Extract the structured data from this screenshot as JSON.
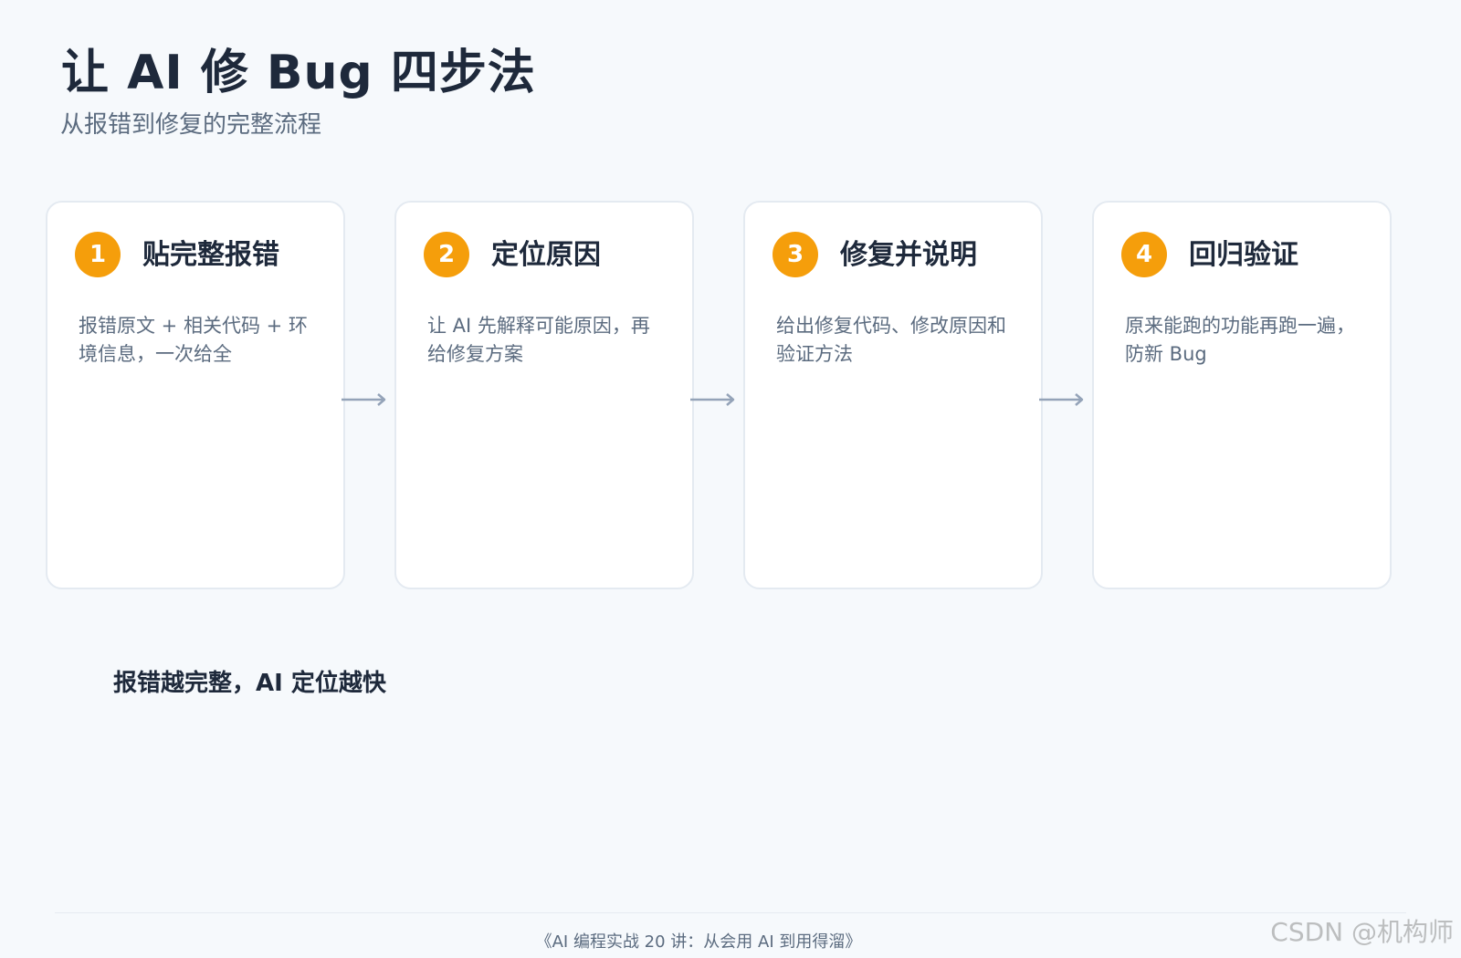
{
  "header": {
    "title": "让 AI 修 Bug 四步法",
    "subtitle": "从报错到修复的完整流程"
  },
  "steps": [
    {
      "number": "1",
      "title": "贴完整报错",
      "description": "报错原文 + 相关代码 + 环境信息，一次给全"
    },
    {
      "number": "2",
      "title": "定位原因",
      "description": "让 AI 先解释可能原因，再给修复方案"
    },
    {
      "number": "3",
      "title": "修复并说明",
      "description": "给出修复代码、修改原因和验证方法"
    },
    {
      "number": "4",
      "title": "回归验证",
      "description": "原来能跑的功能再跑一遍，防新 Bug"
    }
  ],
  "tagline": "报错越完整，AI 定位越快",
  "footer": {
    "text": "《AI 编程实战 20 讲：从会用 AI 到用得溜》"
  },
  "watermark": "CSDN @机构师",
  "colors": {
    "accent": "#f59e0b",
    "background": "#f6f9fc",
    "card": "#ffffff",
    "arrow": "#94a3b8"
  }
}
